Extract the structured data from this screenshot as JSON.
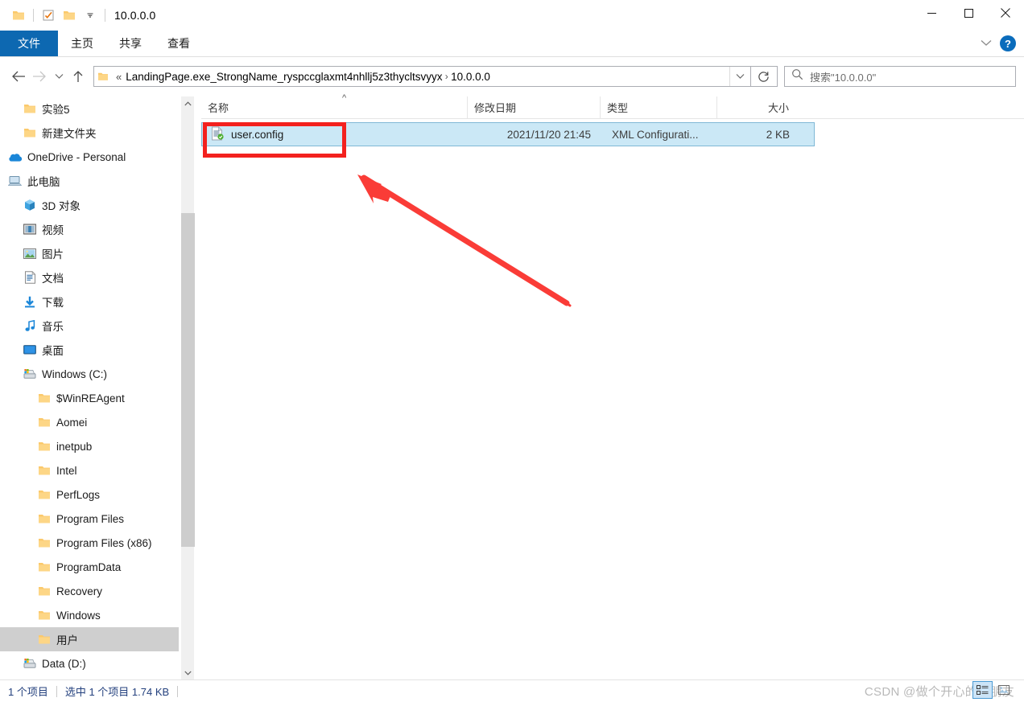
{
  "window": {
    "title": "10.0.0.0",
    "quick_access": [
      {
        "name": "folder-icon",
        "label": ""
      },
      {
        "name": "properties-checkbox-icon",
        "label": ""
      },
      {
        "name": "new-folder-icon",
        "label": ""
      },
      {
        "name": "chevron-down-icon",
        "label": ""
      }
    ],
    "controls": {
      "minimize": "minimize-icon",
      "maximize": "maximize-icon",
      "close": "close-icon"
    }
  },
  "ribbon": {
    "tabs": [
      {
        "label": "文件",
        "active": true
      },
      {
        "label": "主页",
        "active": false
      },
      {
        "label": "共享",
        "active": false
      },
      {
        "label": "查看",
        "active": false
      }
    ],
    "expand_icon": "chevron-down-icon",
    "help_label": "?"
  },
  "nav": {
    "back_icon": "back-arrow-icon",
    "forward_icon": "forward-arrow-icon",
    "recent_icon": "chevron-down-icon",
    "up_icon": "up-arrow-icon",
    "breadcrumb_overflow": "«",
    "breadcrumbs": [
      {
        "label": "LandingPage.exe_StrongName_ryspccglaxmt4nhllj5z3thycltsvyyx"
      },
      {
        "label": "10.0.0.0"
      }
    ],
    "dropdown_icon": "chevron-down-icon",
    "refresh_icon": "refresh-icon"
  },
  "search": {
    "icon": "search-icon",
    "placeholder": "搜索\"10.0.0.0\"",
    "value": ""
  },
  "sidebar": {
    "items": [
      {
        "label": "实验5",
        "icon": "folder-icon",
        "indent": 2,
        "selected": false
      },
      {
        "label": "新建文件夹",
        "icon": "folder-icon",
        "indent": 2,
        "selected": false
      },
      {
        "label": "OneDrive - Personal",
        "icon": "onedrive-icon",
        "indent": 1,
        "selected": false
      },
      {
        "label": "此电脑",
        "icon": "this-pc-icon",
        "indent": 1,
        "selected": false
      },
      {
        "label": "3D 对象",
        "icon": "3d-objects-icon",
        "indent": 2,
        "selected": false
      },
      {
        "label": "视频",
        "icon": "videos-icon",
        "indent": 2,
        "selected": false
      },
      {
        "label": "图片",
        "icon": "pictures-icon",
        "indent": 2,
        "selected": false
      },
      {
        "label": "文档",
        "icon": "documents-icon",
        "indent": 2,
        "selected": false
      },
      {
        "label": "下载",
        "icon": "downloads-icon",
        "indent": 2,
        "selected": false
      },
      {
        "label": "音乐",
        "icon": "music-icon",
        "indent": 2,
        "selected": false
      },
      {
        "label": "桌面",
        "icon": "desktop-icon",
        "indent": 2,
        "selected": false
      },
      {
        "label": "Windows (C:)",
        "icon": "drive-icon",
        "indent": 2,
        "selected": false
      },
      {
        "label": "$WinREAgent",
        "icon": "folder-icon",
        "indent": 3,
        "selected": false
      },
      {
        "label": "Aomei",
        "icon": "folder-icon",
        "indent": 3,
        "selected": false
      },
      {
        "label": "inetpub",
        "icon": "folder-icon",
        "indent": 3,
        "selected": false
      },
      {
        "label": "Intel",
        "icon": "folder-icon",
        "indent": 3,
        "selected": false
      },
      {
        "label": "PerfLogs",
        "icon": "folder-icon",
        "indent": 3,
        "selected": false
      },
      {
        "label": "Program Files",
        "icon": "folder-icon",
        "indent": 3,
        "selected": false
      },
      {
        "label": "Program Files (x86)",
        "icon": "folder-icon",
        "indent": 3,
        "selected": false
      },
      {
        "label": "ProgramData",
        "icon": "folder-icon",
        "indent": 3,
        "selected": false
      },
      {
        "label": "Recovery",
        "icon": "folder-icon",
        "indent": 3,
        "selected": false
      },
      {
        "label": "Windows",
        "icon": "folder-icon",
        "indent": 3,
        "selected": false
      },
      {
        "label": "用户",
        "icon": "folder-icon",
        "indent": 3,
        "selected": true
      },
      {
        "label": "Data (D:)",
        "icon": "drive-icon",
        "indent": 2,
        "selected": false
      }
    ],
    "scrollbar": {
      "up_icon": "chevron-up-icon",
      "down_icon": "chevron-down-icon"
    }
  },
  "filelist": {
    "columns": [
      {
        "key": "name",
        "label": "名称",
        "sorted": "asc"
      },
      {
        "key": "date",
        "label": "修改日期",
        "sorted": ""
      },
      {
        "key": "type",
        "label": "类型",
        "sorted": ""
      },
      {
        "key": "size",
        "label": "大小",
        "sorted": ""
      }
    ],
    "sort_caret": "^",
    "rows": [
      {
        "icon": "xml-config-file-icon",
        "name": "user.config",
        "date": "2021/11/20 21:45",
        "type": "XML Configurati...",
        "size": "2 KB",
        "selected": true
      }
    ]
  },
  "annotations": {
    "highlight_color": "#f3211e",
    "rect_target": "user.config",
    "arrow_color": "#fa3c37"
  },
  "statusbar": {
    "item_count": "1 个项目",
    "selection": "选中 1 个项目  1.74 KB",
    "watermark": "CSDN @做个开心的小朋友",
    "view_buttons": [
      {
        "name": "details-view-icon",
        "active": true
      },
      {
        "name": "large-icons-view-icon",
        "active": false
      }
    ]
  }
}
